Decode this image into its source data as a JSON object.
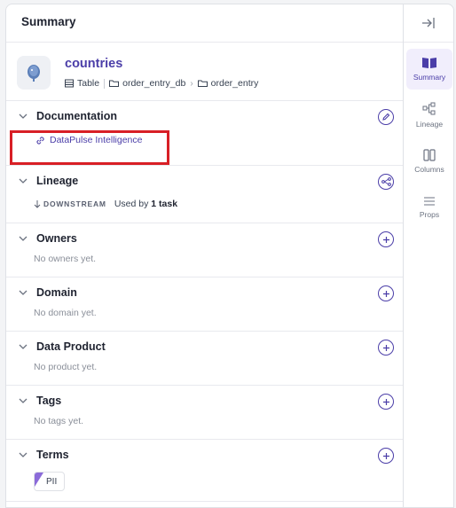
{
  "header": {
    "title": "Summary"
  },
  "entity": {
    "name": "countries",
    "type_label": "Table",
    "path": [
      "order_entry_db",
      "order_entry"
    ]
  },
  "sections": {
    "documentation": {
      "title": "Documentation",
      "link_text": "DataPulse Intelligence"
    },
    "lineage": {
      "title": "Lineage",
      "direction": "DOWNSTREAM",
      "used_by_prefix": "Used by",
      "used_by_count": "1 task"
    },
    "owners": {
      "title": "Owners",
      "empty": "No owners yet."
    },
    "domain": {
      "title": "Domain",
      "empty": "No domain yet."
    },
    "data_product": {
      "title": "Data Product",
      "empty": "No product yet."
    },
    "tags": {
      "title": "Tags",
      "empty": "No tags yet."
    },
    "terms": {
      "title": "Terms",
      "term": "PII"
    }
  },
  "rail": {
    "items": [
      {
        "label": "Summary",
        "icon": "book-icon"
      },
      {
        "label": "Lineage",
        "icon": "lineage-icon"
      },
      {
        "label": "Columns",
        "icon": "columns-icon"
      },
      {
        "label": "Props",
        "icon": "list-icon"
      }
    ]
  },
  "colors": {
    "accent": "#4b3ea8",
    "highlight": "#d81f26",
    "term_tag": "#8b6bd9"
  }
}
